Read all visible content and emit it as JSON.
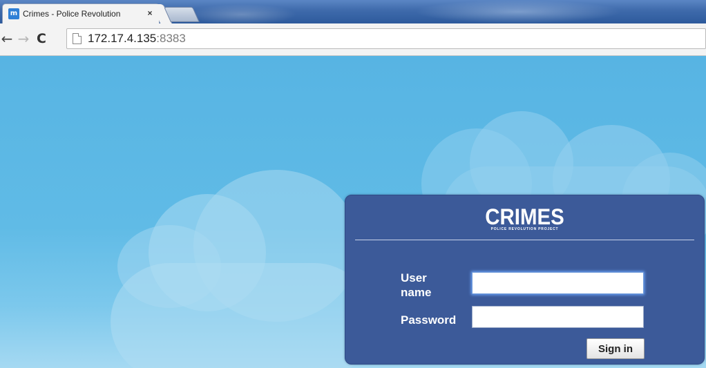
{
  "browser": {
    "tab": {
      "favicon_text": "m",
      "title": "Crimes - Police Revolution",
      "close_glyph": "×"
    },
    "nav": {
      "back_glyph": "←",
      "forward_glyph": "→",
      "reload_glyph": "C"
    },
    "address": {
      "host": "172.17.4.135",
      "port": ":8383"
    }
  },
  "login": {
    "logo_title": "CRIMES",
    "logo_subtitle": "POLICE REVOLUTION PROJECT",
    "username_label": "User name",
    "username_value": "",
    "password_label": "Password",
    "password_value": "",
    "signin_label": "Sign in"
  },
  "colors": {
    "panel": "#3c5a99",
    "sky": "#57b4e3",
    "tabstrip": "#3e6aab"
  },
  "icons": [
    "favicon-icon",
    "close-icon",
    "back-arrow-icon",
    "forward-arrow-icon",
    "reload-icon",
    "page-icon"
  ]
}
